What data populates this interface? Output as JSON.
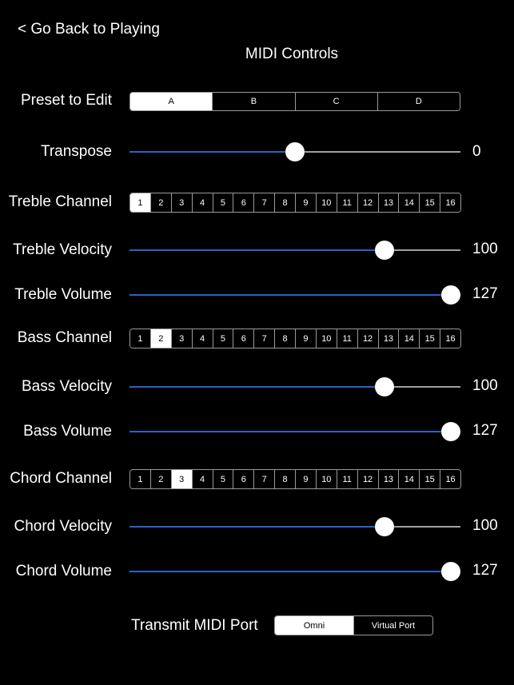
{
  "header": {
    "back_label": "< Go Back to Playing",
    "title": "MIDI Controls"
  },
  "preset": {
    "label": "Preset to Edit",
    "options": [
      "A",
      "B",
      "C",
      "D"
    ],
    "selected": 0
  },
  "transpose": {
    "label": "Transpose",
    "value": "0",
    "min": -12,
    "max": 12,
    "current": 0
  },
  "channel_options": [
    "1",
    "2",
    "3",
    "4",
    "5",
    "6",
    "7",
    "8",
    "9",
    "10",
    "11",
    "12",
    "13",
    "14",
    "15",
    "16"
  ],
  "treble": {
    "channel_label": "Treble Channel",
    "channel_selected": 0,
    "velocity_label": "Treble Velocity",
    "velocity_value": "100",
    "volume_label": "Treble Volume",
    "volume_value": "127"
  },
  "bass": {
    "channel_label": "Bass Channel",
    "channel_selected": 1,
    "velocity_label": "Bass Velocity",
    "velocity_value": "100",
    "volume_label": "Bass Volume",
    "volume_value": "127"
  },
  "chord": {
    "channel_label": "Chord Channel",
    "channel_selected": 2,
    "velocity_label": "Chord Velocity",
    "velocity_value": "100",
    "volume_label": "Chord Volume",
    "volume_value": "127"
  },
  "midi_range": {
    "min": 0,
    "max": 127
  },
  "port": {
    "label": "Transmit MIDI Port",
    "options": [
      "Omni",
      "Virtual Port"
    ],
    "selected": 0
  },
  "colors": {
    "accent": "#2b63c6",
    "track": "#a0a0a0",
    "background": "#000000"
  }
}
